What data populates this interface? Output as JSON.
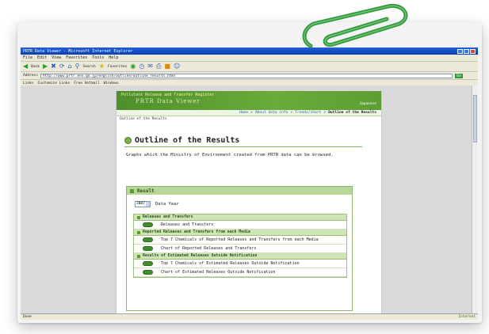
{
  "window": {
    "title": "PRTR Data Viewer - Microsoft Internet Explorer",
    "menu": [
      "File",
      "Edit",
      "View",
      "Favorites",
      "Tools",
      "Help"
    ],
    "toolbar": {
      "back_label": "Back",
      "search_label": "Search",
      "favorites_label": "Favorites"
    },
    "address_label": "Address",
    "address_url": "http://www.prtr.env.go.jp/english/outline/outline_results.html",
    "go_label": "Go",
    "links": [
      "Links",
      "Customize Links",
      "Free Hotmail",
      "Windows"
    ],
    "status_left": "Done",
    "status_zone": "Internet"
  },
  "page": {
    "banner_small": "Pollutant Release and Transfer Register",
    "banner_title": "PRTR Data Viewer",
    "banner_lang": "Japanese",
    "breadcrumbs": [
      "Home",
      "About data info",
      "Trends/chart",
      "Outline of the Results"
    ],
    "path": "Outline of the Results",
    "heading": "Outline of the Results",
    "description": "Graphs which the Ministry of Environment created from PRTR data can be browsed.",
    "results": {
      "title": "Result",
      "year_value": "2007",
      "year_label": "Data Year",
      "sections": [
        {
          "title": "Releases and Transfers",
          "rows": [
            "Releases and Transfers"
          ]
        },
        {
          "title": "Reported Releases and Transfers from each Media",
          "rows": [
            "Top 7 Chemicals of Reported Releases and Transfers from each Media",
            "Chart of Reported Releases and Transfers"
          ]
        },
        {
          "title": "Results of Estimated Releases Outside Notification",
          "rows": [
            "Top 7 Chemicals of Estimated Releases Outside Notification",
            "Chart of Estimated Releases Outside Notification"
          ]
        }
      ]
    }
  },
  "colors": {
    "accent": "#6aab3c",
    "section_bg": "#cfe5b8",
    "clip": "#2f9a3a"
  }
}
